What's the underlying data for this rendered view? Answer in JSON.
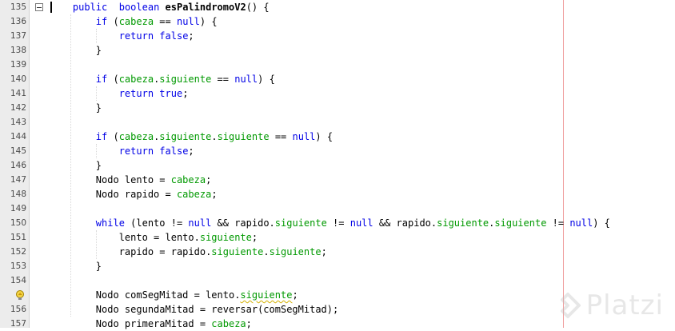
{
  "editor": {
    "lines": [
      {
        "num": "135",
        "indent": "    ",
        "tokens": [
          [
            "kw",
            "public"
          ],
          [
            "",
            "  "
          ],
          [
            "kw",
            "boolean"
          ],
          [
            "",
            " "
          ],
          [
            "bold",
            "esPalindromoV2"
          ],
          [
            "",
            "() {"
          ]
        ]
      },
      {
        "num": "136",
        "indent": "        ",
        "tokens": [
          [
            "kw",
            "if"
          ],
          [
            "",
            " ("
          ],
          [
            "fld",
            "cabeza"
          ],
          [
            "",
            " == "
          ],
          [
            "kw",
            "null"
          ],
          [
            "",
            ") {"
          ]
        ]
      },
      {
        "num": "137",
        "indent": "            ",
        "tokens": [
          [
            "kw",
            "return"
          ],
          [
            "",
            " "
          ],
          [
            "kw",
            "false"
          ],
          [
            "",
            ";"
          ]
        ]
      },
      {
        "num": "138",
        "indent": "        ",
        "tokens": [
          [
            "",
            "}"
          ]
        ]
      },
      {
        "num": "139",
        "indent": "",
        "tokens": []
      },
      {
        "num": "140",
        "indent": "        ",
        "tokens": [
          [
            "kw",
            "if"
          ],
          [
            "",
            " ("
          ],
          [
            "fld",
            "cabeza"
          ],
          [
            "",
            "."
          ],
          [
            "fld",
            "siguiente"
          ],
          [
            "",
            " == "
          ],
          [
            "kw",
            "null"
          ],
          [
            "",
            ") {"
          ]
        ]
      },
      {
        "num": "141",
        "indent": "            ",
        "tokens": [
          [
            "kw",
            "return"
          ],
          [
            "",
            " "
          ],
          [
            "kw",
            "true"
          ],
          [
            "",
            ";"
          ]
        ]
      },
      {
        "num": "142",
        "indent": "        ",
        "tokens": [
          [
            "",
            "}"
          ]
        ]
      },
      {
        "num": "143",
        "indent": "",
        "tokens": []
      },
      {
        "num": "144",
        "indent": "        ",
        "tokens": [
          [
            "kw",
            "if"
          ],
          [
            "",
            " ("
          ],
          [
            "fld",
            "cabeza"
          ],
          [
            "",
            "."
          ],
          [
            "fld",
            "siguiente"
          ],
          [
            "",
            "."
          ],
          [
            "fld",
            "siguiente"
          ],
          [
            "",
            " == "
          ],
          [
            "kw",
            "null"
          ],
          [
            "",
            ") {"
          ]
        ]
      },
      {
        "num": "145",
        "indent": "            ",
        "tokens": [
          [
            "kw",
            "return"
          ],
          [
            "",
            " "
          ],
          [
            "kw",
            "false"
          ],
          [
            "",
            ";"
          ]
        ]
      },
      {
        "num": "146",
        "indent": "        ",
        "tokens": [
          [
            "",
            "}"
          ]
        ]
      },
      {
        "num": "147",
        "indent": "        ",
        "tokens": [
          [
            "",
            "Nodo lento = "
          ],
          [
            "fld",
            "cabeza"
          ],
          [
            "",
            ";"
          ]
        ]
      },
      {
        "num": "148",
        "indent": "        ",
        "tokens": [
          [
            "",
            "Nodo rapido = "
          ],
          [
            "fld",
            "cabeza"
          ],
          [
            "",
            ";"
          ]
        ]
      },
      {
        "num": "149",
        "indent": "",
        "tokens": []
      },
      {
        "num": "150",
        "indent": "        ",
        "tokens": [
          [
            "kw",
            "while"
          ],
          [
            "",
            " (lento != "
          ],
          [
            "kw",
            "null"
          ],
          [
            "",
            " && rapido."
          ],
          [
            "fld",
            "siguiente"
          ],
          [
            "",
            " != "
          ],
          [
            "kw",
            "null"
          ],
          [
            "",
            " && rapido."
          ],
          [
            "fld",
            "siguiente"
          ],
          [
            "",
            "."
          ],
          [
            "fld",
            "siguiente"
          ],
          [
            "",
            " != "
          ],
          [
            "kw",
            "null"
          ],
          [
            "",
            ") {"
          ]
        ]
      },
      {
        "num": "151",
        "indent": "            ",
        "tokens": [
          [
            "",
            "lento = lento."
          ],
          [
            "fld",
            "siguiente"
          ],
          [
            "",
            ";"
          ]
        ]
      },
      {
        "num": "152",
        "indent": "            ",
        "tokens": [
          [
            "",
            "rapido = rapido."
          ],
          [
            "fld",
            "siguiente"
          ],
          [
            "",
            "."
          ],
          [
            "fld",
            "siguiente"
          ],
          [
            "",
            ";"
          ]
        ]
      },
      {
        "num": "153",
        "indent": "        ",
        "tokens": [
          [
            "",
            "}"
          ]
        ]
      },
      {
        "num": "154",
        "indent": "",
        "tokens": []
      },
      {
        "num": "",
        "warning": true,
        "indent": "        ",
        "tokens": [
          [
            "",
            "Nodo comSegMitad = lento."
          ],
          [
            "fld squiggle",
            "siguiente"
          ],
          [
            "",
            ";"
          ]
        ]
      },
      {
        "num": "156",
        "indent": "        ",
        "tokens": [
          [
            "",
            "Nodo segundaMitad = reversar(comSegMitad);"
          ]
        ]
      },
      {
        "num": "157",
        "indent": "        ",
        "tokens": [
          [
            "",
            "Nodo primeraMitad = "
          ],
          [
            "fld",
            "cabeza"
          ],
          [
            "",
            ";"
          ]
        ]
      }
    ]
  },
  "colors": {
    "keyword": "#0000e6",
    "field": "#009900",
    "gutter": "#ececec",
    "margin_line": "#f0a0a0"
  },
  "icons": {
    "warning": "lightbulb-warning-icon",
    "fold": "fold-collapse-icon",
    "watermark_logo": "platzi-logo-icon"
  },
  "watermark": {
    "text": "Platzi"
  }
}
